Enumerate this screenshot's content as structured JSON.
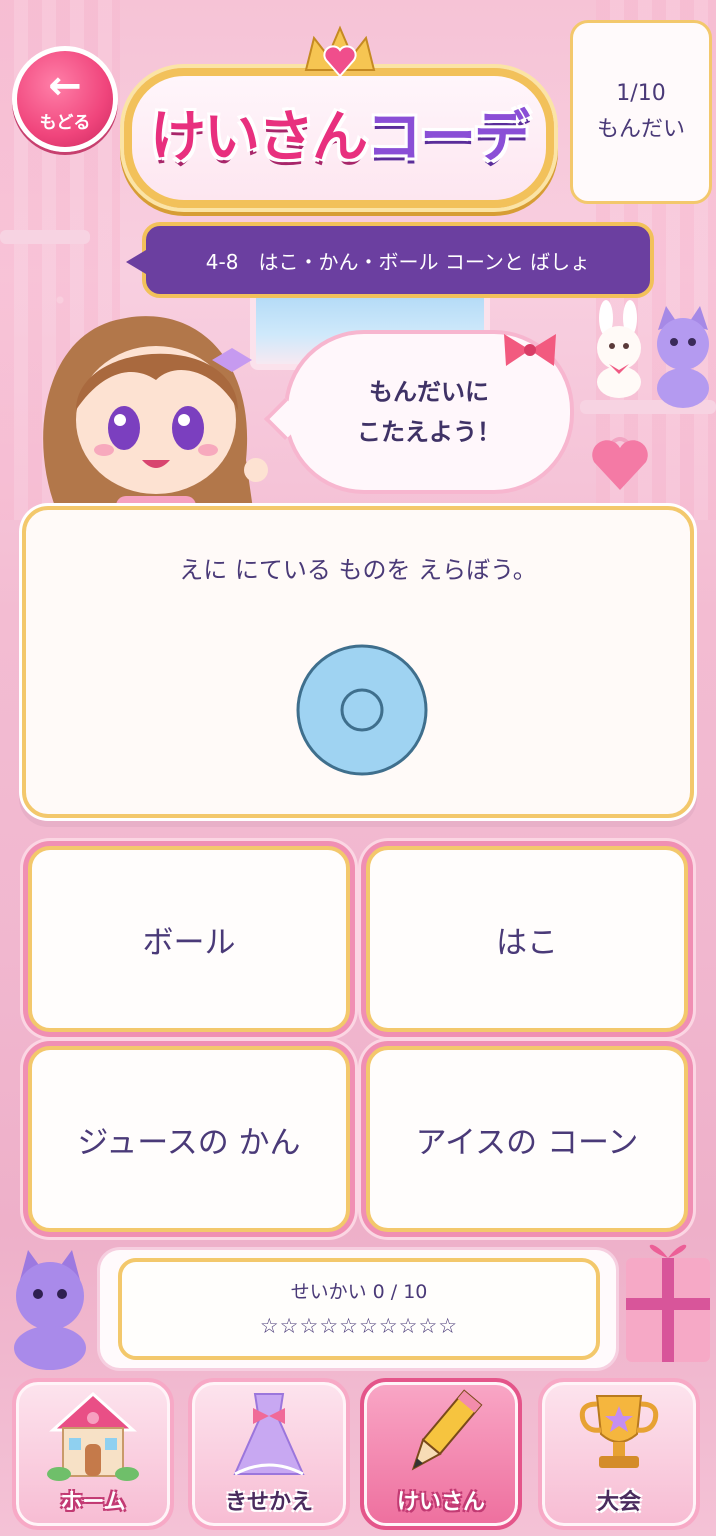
{
  "header": {
    "back_label": "もどる",
    "title_part1": "けいさん",
    "title_part2": "コーデ",
    "progress_count": "1/10",
    "progress_label": "もんだい"
  },
  "lesson": {
    "title": "4-8　はこ・かん・ボール コーンと ばしょ"
  },
  "speech": {
    "line1": "もんだいに",
    "line2": "こたえよう！"
  },
  "question": {
    "text": "えに にている ものを えらぼう。",
    "image_icon": "tape-roll-icon"
  },
  "answers": [
    {
      "label": "ボール"
    },
    {
      "label": "はこ"
    },
    {
      "label": "ジュースの かん"
    },
    {
      "label": "アイスの コーン"
    }
  ],
  "score": {
    "text": "せいかい 0 / 10",
    "stars": "☆☆☆☆☆☆☆☆☆☆"
  },
  "nav": [
    {
      "label": "ホーム",
      "icon": "house-icon"
    },
    {
      "label": "きせかえ",
      "icon": "dress-icon"
    },
    {
      "label": "けいさん",
      "icon": "pencil-icon",
      "active": true
    },
    {
      "label": "大会",
      "icon": "trophy-icon"
    }
  ],
  "colors": {
    "accent_pink": "#e8307e",
    "accent_purple": "#6b3fa0",
    "gold": "#f3c86c",
    "text": "#4a3a78"
  }
}
